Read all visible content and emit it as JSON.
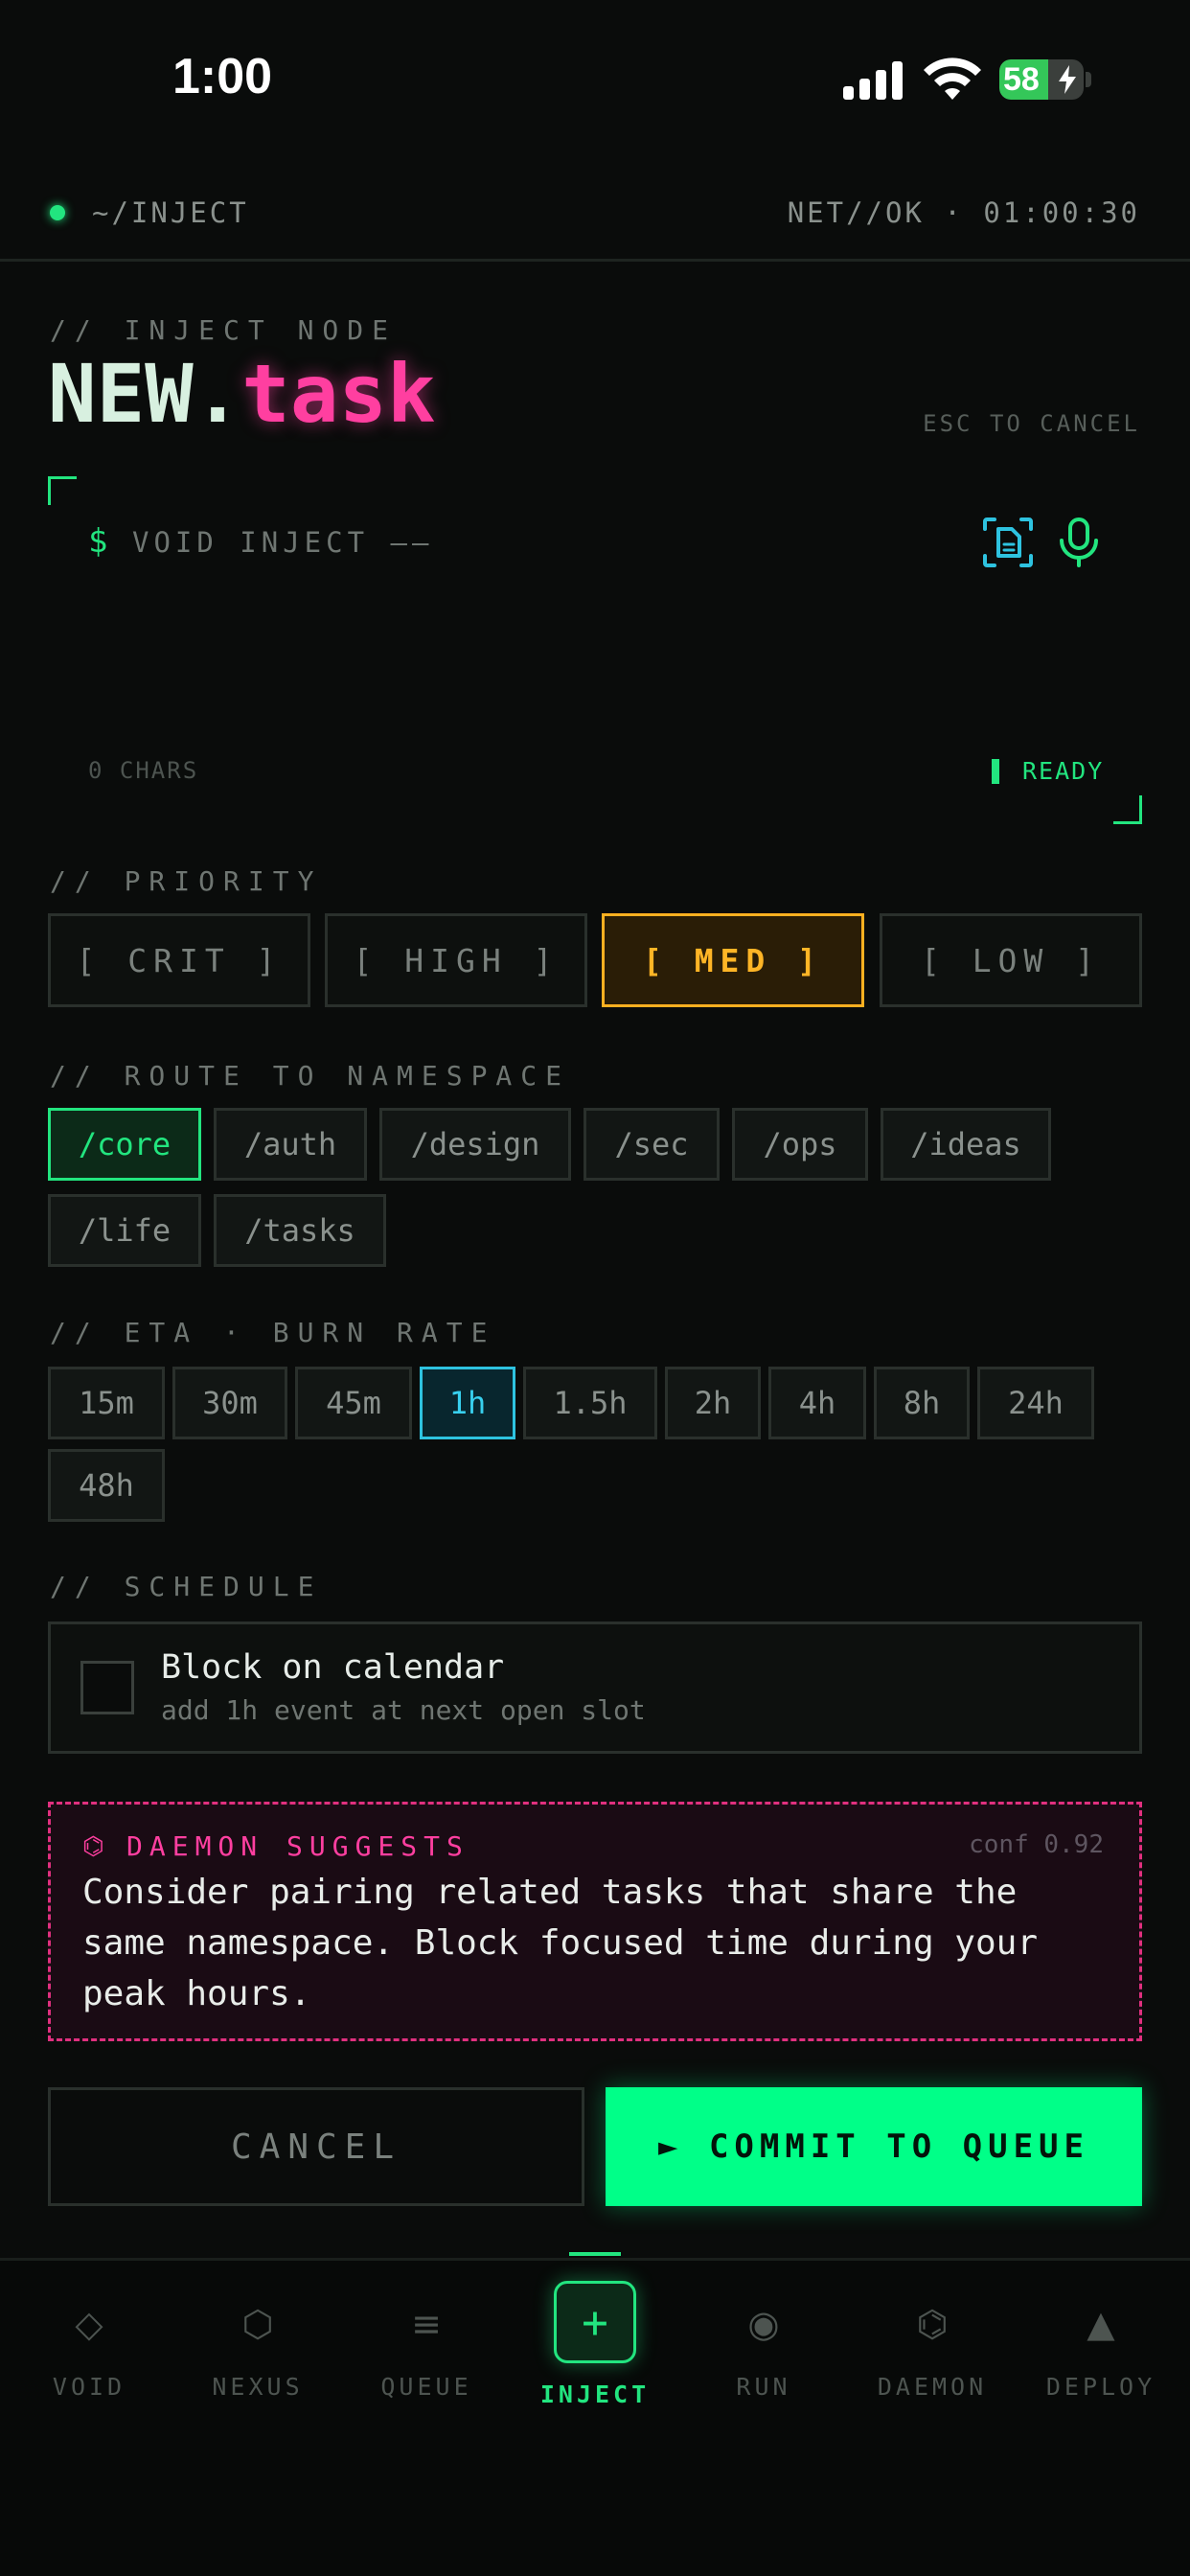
{
  "status_bar": {
    "time": "1:00",
    "battery": "58",
    "battery_level": 0.58
  },
  "top_bar": {
    "path": "~/INJECT",
    "net_status": "NET//OK · 01:00:30"
  },
  "header": {
    "section": "// INJECT NODE",
    "title_prefix": "NEW.",
    "title_accent": "task",
    "esc_hint": "ESC TO CANCEL"
  },
  "input": {
    "prompt_symbol": "$",
    "placeholder": "VOID INJECT ——",
    "char_count": "0 CHARS",
    "state": "READY",
    "icons": [
      "scan-doc-icon",
      "microphone-icon"
    ]
  },
  "priority": {
    "label": "// PRIORITY",
    "options": [
      "[ CRIT ]",
      "[ HIGH ]",
      "[ MED ]",
      "[ LOW ]"
    ],
    "selected": "[ MED ]",
    "selected_color": "#ffb020"
  },
  "namespace": {
    "label": "// ROUTE TO NAMESPACE",
    "options": [
      "/core",
      "/auth",
      "/design",
      "/sec",
      "/ops",
      "/ideas",
      "/life",
      "/tasks"
    ],
    "selected": "/core",
    "selected_color": "#22e57f"
  },
  "eta": {
    "label": "// ETA · BURN RATE",
    "options": [
      "15m",
      "30m",
      "45m",
      "1h",
      "1.5h",
      "2h",
      "4h",
      "8h",
      "24h",
      "48h"
    ],
    "selected": "1h",
    "selected_color": "#2ec3e0"
  },
  "schedule": {
    "label": "// SCHEDULE",
    "checkbox_title": "Block on calendar",
    "checkbox_subtitle": "add 1h event at next open slot",
    "checked": false
  },
  "daemon": {
    "icon": "⌬",
    "label": "DAEMON SUGGESTS",
    "confidence": "conf 0.92",
    "text": "Consider pairing related tasks that share the same namespace. Block focused time during your peak hours."
  },
  "actions": {
    "cancel": "CANCEL",
    "commit": "► COMMIT TO QUEUE",
    "commit_color": "#00ff88"
  },
  "tabs": [
    {
      "label": "VOID",
      "icon": "◇"
    },
    {
      "label": "NEXUS",
      "icon": "⬡"
    },
    {
      "label": "QUEUE",
      "icon": "≡"
    },
    {
      "label": "INJECT",
      "icon": "+"
    },
    {
      "label": "RUN",
      "icon": "◉"
    },
    {
      "label": "DAEMON",
      "icon": "⌬"
    },
    {
      "label": "DEPLOY",
      "icon": "▲"
    }
  ],
  "active_tab": "INJECT",
  "accent": "#22e57f",
  "title_accent_color": "#ff3fa0"
}
